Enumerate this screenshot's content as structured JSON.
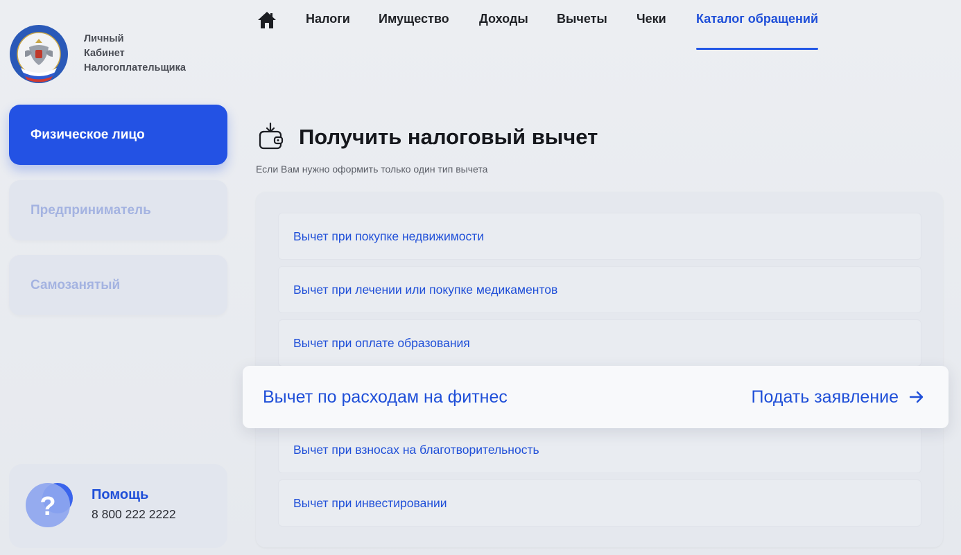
{
  "brand": {
    "lines": [
      "Личный",
      "Кабинет",
      "Налогоплательщика"
    ]
  },
  "nav": {
    "items": [
      {
        "label": "Налоги"
      },
      {
        "label": "Имущество"
      },
      {
        "label": "Доходы"
      },
      {
        "label": "Вычеты"
      },
      {
        "label": "Чеки"
      },
      {
        "label": "Каталог обращений",
        "active": true
      }
    ]
  },
  "sidebar": {
    "items": [
      {
        "label": "Физическое лицо",
        "active": true
      },
      {
        "label": "Предприниматель"
      },
      {
        "label": "Самозанятый"
      }
    ],
    "help": {
      "title": "Помощь",
      "phone": "8 800 222 2222"
    }
  },
  "main": {
    "title": "Получить налоговый вычет",
    "subtitle": "Если Вам нужно оформить только один тип вычета",
    "rows": [
      "Вычет при покупке недвижимости",
      "Вычет при лечении или покупке медикаментов",
      "Вычет при оплате образования",
      "Вычет при взносах на благотворительность",
      "Вычет при инвестировании"
    ],
    "highlight": {
      "label": "Вычет по расходам на фитнес",
      "action": "Подать заявление"
    }
  },
  "colors": {
    "accent": "#2352e4",
    "link": "#1f4fd8",
    "background": "#e8ebf0"
  },
  "icons": [
    "fns-emblem-logo",
    "home-icon",
    "wallet-download-icon",
    "question-icon",
    "arrow-right-icon"
  ]
}
